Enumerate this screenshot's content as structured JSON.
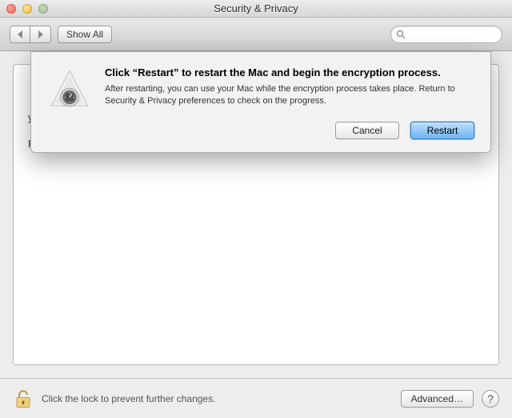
{
  "window": {
    "title": "Security & Privacy"
  },
  "toolbar": {
    "back_label": "Back",
    "forward_label": "Forward",
    "show_all_label": "Show All",
    "search_placeholder": ""
  },
  "pane": {
    "recovery_line1": "",
    "recovery_line2": "your password and recovery key, the data will be lost.",
    "status": "FileVault is turned off for the disk “Macintosh HD”."
  },
  "bottom": {
    "lock_text": "Click the lock to prevent further changes.",
    "advanced_label": "Advanced…",
    "help_label": "?"
  },
  "sheet": {
    "title": "Click “Restart” to restart the Mac and begin the encryption process.",
    "message": "After restarting, you can use your Mac while the encryption process takes place. Return to Security & Privacy preferences to check on the progress.",
    "cancel_label": "Cancel",
    "restart_label": "Restart"
  }
}
